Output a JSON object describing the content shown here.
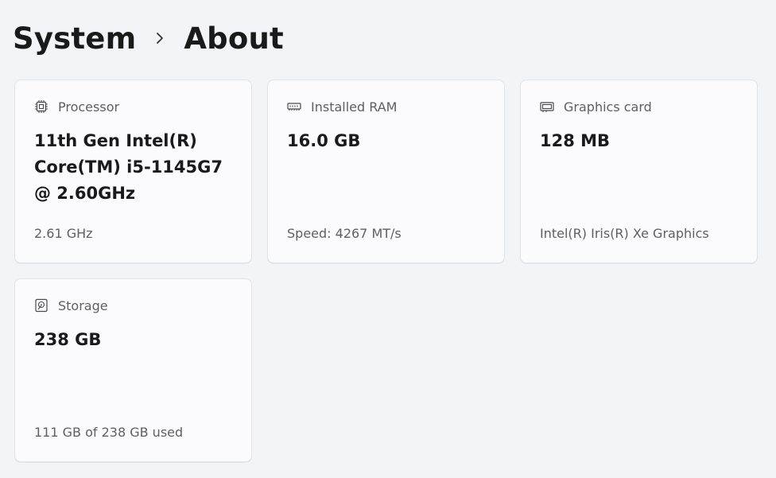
{
  "breadcrumb": {
    "parent": "System",
    "current": "About"
  },
  "cards": {
    "processor": {
      "title": "Processor",
      "icon": "processor-chip-icon",
      "value": "11th Gen Intel(R) Core(TM) i5-1145G7 @ 2.60GHz",
      "sub": "2.61 GHz"
    },
    "ram": {
      "title": "Installed RAM",
      "icon": "memory-icon",
      "value": "16.0 GB",
      "sub": "Speed: 4267 MT/s"
    },
    "graphics": {
      "title": "Graphics card",
      "icon": "graphics-card-icon",
      "value": "128 MB",
      "sub": "Intel(R) Iris(R) Xe Graphics"
    },
    "storage": {
      "title": "Storage",
      "icon": "hard-drive-icon",
      "value": "238 GB",
      "sub": "111 GB of 238 GB used"
    }
  },
  "colors": {
    "background": "#f3f4f8",
    "card": "#fbfbfe",
    "card_border": "#e1e3e8",
    "secondary_text": "#5f5f5f"
  }
}
